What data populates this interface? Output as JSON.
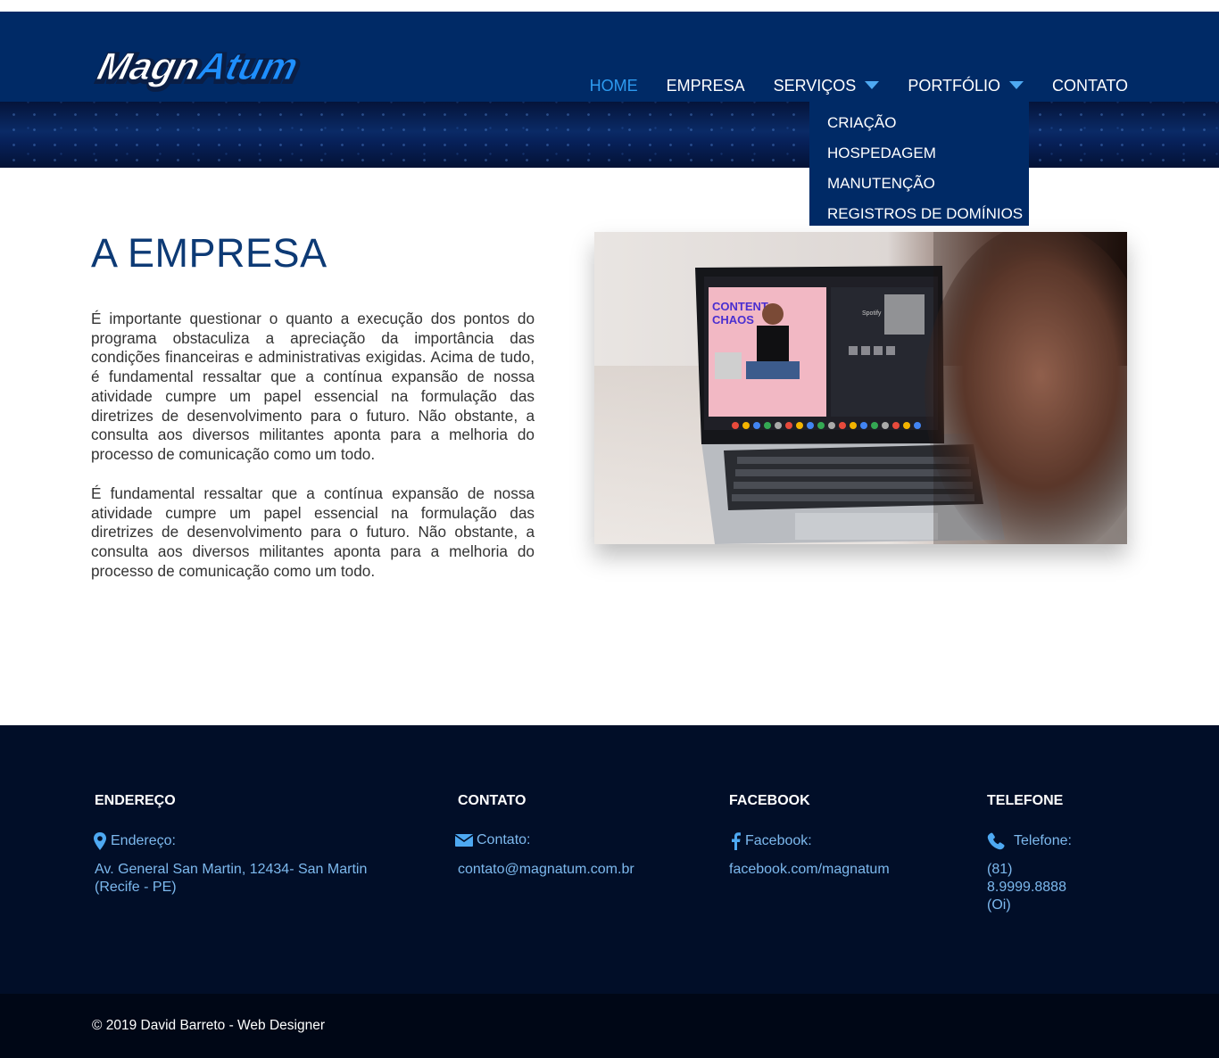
{
  "header": {
    "logo": {
      "part1": "Magn",
      "part2": "Atum",
      "colors": {
        "part1": "#ffffff",
        "part2": "#1e8fff"
      }
    },
    "nav": [
      {
        "label": "HOME",
        "active": true
      },
      {
        "label": "EMPRESA",
        "active": false
      },
      {
        "label": "SERVIÇOS",
        "active": false,
        "has_dropdown": true
      },
      {
        "label": "PORTFÓLIO",
        "active": false,
        "has_dropdown": true
      },
      {
        "label": "CONTATO",
        "active": false
      }
    ],
    "dropdown_items": [
      "CRIAÇÃO",
      "HOSPEDAGEM",
      "MANUTENÇÃO",
      "REGISTROS DE DOMÍNIOS"
    ]
  },
  "main": {
    "title": "A EMPRESA",
    "paragraphs": [
      "É importante questionar o quanto a execução dos pontos do programa obstaculiza a apreciação da importância das condições financeiras e administrativas exigidas. Acima de tudo, é fundamental ressaltar que a contínua expansão de nossa atividade cumpre um papel essencial na formulação das diretrizes de desenvolvimento para o futuro. Não obstante, a consulta aos diversos militantes aponta para a melhoria do processo de comunicação como um todo.",
      "É fundamental ressaltar que a contínua expansão de nossa atividade cumpre um papel essencial na formulação das diretrizes de desenvolvimento para o futuro. Não obstante, a consulta aos diversos militantes aponta para a melhoria do processo de comunicação como um todo."
    ],
    "photo": {
      "screen_title_line1": "CONTENT",
      "screen_title_line2": "CHAOS",
      "screen_app": "Spotify"
    }
  },
  "footer": {
    "columns": [
      {
        "heading": "ENDEREÇO",
        "icon": "map-pin-icon",
        "label": "Endereço:",
        "value": "Av. General San Martin, 12434- San Martin (Recife - PE)"
      },
      {
        "heading": "CONTATO",
        "icon": "envelope-icon",
        "label": "Contato:",
        "value": "contato@magnatum.com.br"
      },
      {
        "heading": "FACEBOOK",
        "icon": "facebook-icon",
        "label": "Facebook:",
        "value": "facebook.com/magnatum"
      },
      {
        "heading": "TELEFONE",
        "icon": "phone-icon",
        "label": "Telefone:",
        "value": "(81) 8.9999.8888 (Oi)"
      }
    ],
    "copyright": "© 2019 David Barreto - Web Designer"
  },
  "colors": {
    "header_bg": "#002a66",
    "nav_active": "#2d9bf0",
    "title": "#0d3a75",
    "footer_bg": "#010e28",
    "footer_link": "#7db9ee",
    "copyright_bg": "#000716"
  }
}
